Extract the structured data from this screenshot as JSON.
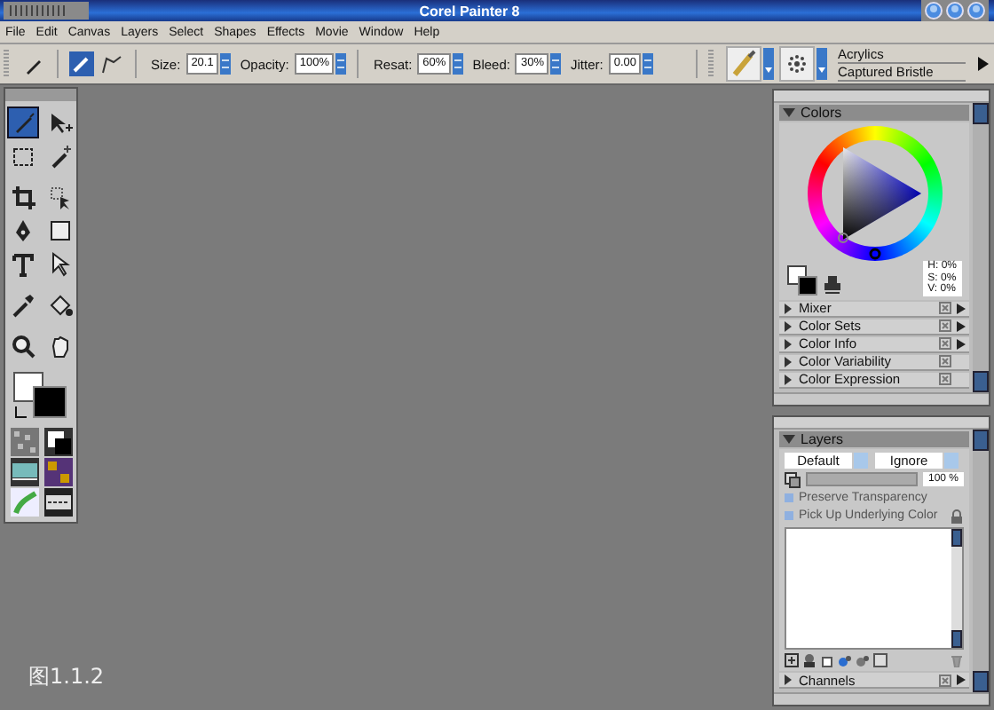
{
  "window": {
    "title": "Corel Painter 8"
  },
  "menu": [
    "File",
    "Edit",
    "Canvas",
    "Layers",
    "Select",
    "Shapes",
    "Effects",
    "Movie",
    "Window",
    "Help"
  ],
  "property_bar": {
    "fields": [
      {
        "label": "Size:",
        "value": "20.1"
      },
      {
        "label": "Opacity:",
        "value": "100%"
      },
      {
        "label": "Resat:",
        "value": "60%"
      },
      {
        "label": "Bleed:",
        "value": "30%"
      },
      {
        "label": "Jitter:",
        "value": "0.00"
      }
    ],
    "brush_category": "Acrylics",
    "brush_variant": "Captured Bristle"
  },
  "tools": [
    {
      "kind": "brush",
      "selected": true
    },
    {
      "kind": "arrow",
      "selected": false
    },
    {
      "kind": "marquee",
      "selected": false
    },
    {
      "kind": "wand",
      "selected": false
    },
    {
      "kind": "crop",
      "selected": false
    },
    {
      "kind": "move",
      "selected": false
    },
    {
      "kind": "pen",
      "selected": false
    },
    {
      "kind": "rect",
      "selected": false
    },
    {
      "kind": "text",
      "selected": false
    },
    {
      "kind": "pointer",
      "selected": false
    },
    {
      "kind": "dropper",
      "selected": false
    },
    {
      "kind": "bucket",
      "selected": false
    },
    {
      "kind": "zoom",
      "selected": false
    },
    {
      "kind": "hand",
      "selected": false
    }
  ],
  "colors_palette": {
    "title": "Colors",
    "expanded": true,
    "readout": [
      "H: 0%",
      "S: 0%",
      "V: 0%"
    ],
    "sections": [
      {
        "title": "Mixer",
        "expanded": false,
        "has_menu": true
      },
      {
        "title": "Color Sets",
        "expanded": false,
        "has_menu": true
      },
      {
        "title": "Color Info",
        "expanded": false,
        "has_menu": true
      },
      {
        "title": "Color Variability",
        "expanded": false,
        "has_menu": false
      },
      {
        "title": "Color Expression",
        "expanded": false,
        "has_menu": false
      }
    ]
  },
  "layers_palette": {
    "title": "Layers",
    "expanded": true,
    "composite_method": "Default",
    "composite_depth": "Ignore",
    "opacity": "100 %",
    "opacity_slider": {
      "level": 1
    },
    "options": [
      {
        "label": "Preserve Transparency",
        "checked": false
      },
      {
        "label": "Pick Up Underlying Color",
        "checked": false
      }
    ],
    "sections": [
      {
        "title": "Channels",
        "expanded": false,
        "has_menu": true
      }
    ]
  },
  "caption": "图1.1.2"
}
